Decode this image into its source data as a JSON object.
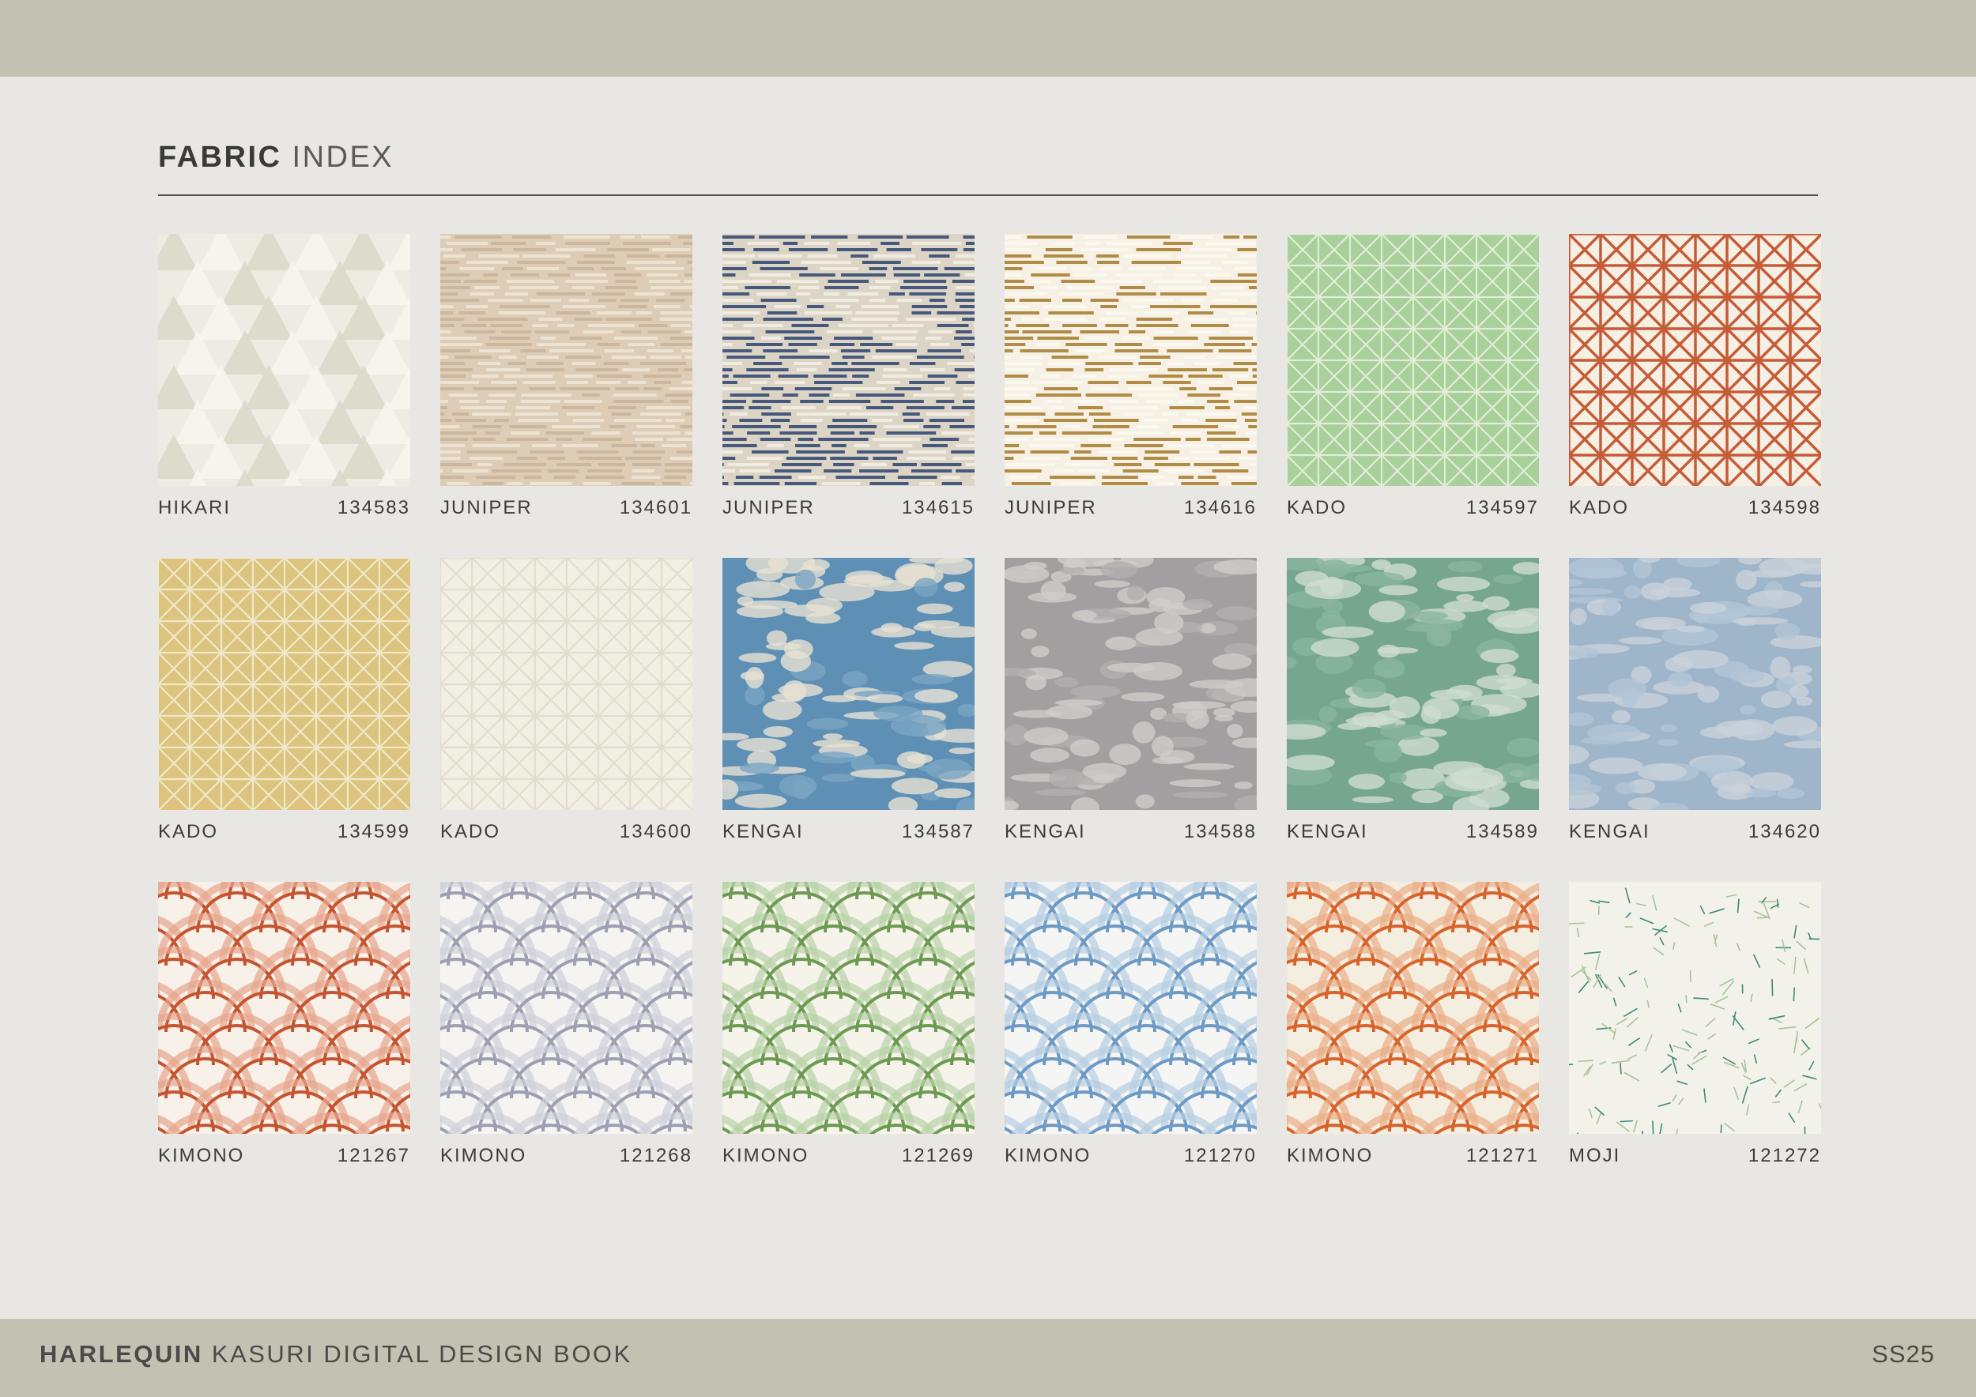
{
  "header": {
    "title_bold": "FABRIC",
    "title_light": "INDEX"
  },
  "footer": {
    "brand": "HARLEQUIN",
    "book": "KASURI DIGITAL DESIGN BOOK",
    "season": "SS25"
  },
  "fabrics": [
    {
      "name": "HIKARI",
      "code": "134583",
      "pattern": "trees",
      "colors": [
        "#edebe2",
        "#f8f6ef",
        "#d8d8c8"
      ]
    },
    {
      "name": "JUNIPER",
      "code": "134601",
      "pattern": "dashes",
      "colors": [
        "#ddcdb6",
        "#ede3d3",
        "#cbb79d"
      ]
    },
    {
      "name": "JUNIPER",
      "code": "134615",
      "pattern": "dashes",
      "colors": [
        "#dcd5c6",
        "#f1ece1",
        "#46587c"
      ]
    },
    {
      "name": "JUNIPER",
      "code": "134616",
      "pattern": "dashes",
      "colors": [
        "#f6f1e4",
        "#fbf8ef",
        "#b08c47"
      ]
    },
    {
      "name": "KADO",
      "code": "134597",
      "pattern": "lattice",
      "colors": [
        "#a9cf9a",
        "#cfe5c5",
        "#e3f0dc"
      ]
    },
    {
      "name": "KADO",
      "code": "134598",
      "pattern": "lattice",
      "colors": [
        "#f6efe3",
        "#f6efe3",
        "#c4542f"
      ]
    },
    {
      "name": "KADO",
      "code": "134599",
      "pattern": "lattice",
      "colors": [
        "#dcc47e",
        "#e7d59e",
        "#f3ead0"
      ]
    },
    {
      "name": "KADO",
      "code": "134600",
      "pattern": "lattice",
      "colors": [
        "#f1eee4",
        "#f6f3ec",
        "#e2ddd0"
      ]
    },
    {
      "name": "KENGAI",
      "code": "134587",
      "pattern": "clouds",
      "colors": [
        "#5e8fb4",
        "#e7e1d3",
        "#7aa5c4"
      ]
    },
    {
      "name": "KENGAI",
      "code": "134588",
      "pattern": "clouds",
      "colors": [
        "#a19fa0",
        "#cfcdc9",
        "#b1afaf"
      ]
    },
    {
      "name": "KENGAI",
      "code": "134589",
      "pattern": "clouds",
      "colors": [
        "#76a690",
        "#cfdcd2",
        "#8ab5a0"
      ]
    },
    {
      "name": "KENGAI",
      "code": "134620",
      "pattern": "clouds",
      "colors": [
        "#9fb6ca",
        "#c9d2da",
        "#b2c6d6"
      ]
    },
    {
      "name": "KIMONO",
      "code": "121267",
      "pattern": "arches",
      "colors": [
        "#f8f1ea",
        "#c55430",
        "#e7a58c"
      ]
    },
    {
      "name": "KIMONO",
      "code": "121268",
      "pattern": "arches",
      "colors": [
        "#f6f4f1",
        "#9d9fb2",
        "#cfd0da"
      ]
    },
    {
      "name": "KIMONO",
      "code": "121269",
      "pattern": "arches",
      "colors": [
        "#f5f3ea",
        "#6d9a52",
        "#b8d1a6"
      ]
    },
    {
      "name": "KIMONO",
      "code": "121270",
      "pattern": "arches",
      "colors": [
        "#f5f5f4",
        "#6d9ac4",
        "#b5cde3"
      ]
    },
    {
      "name": "KIMONO",
      "code": "121271",
      "pattern": "arches",
      "colors": [
        "#f4eee1",
        "#d8642c",
        "#e9ae86"
      ]
    },
    {
      "name": "MOJI",
      "code": "121272",
      "pattern": "leaves",
      "colors": [
        "#f2f2ea",
        "#3f8a72",
        "#a9c39a"
      ]
    }
  ]
}
